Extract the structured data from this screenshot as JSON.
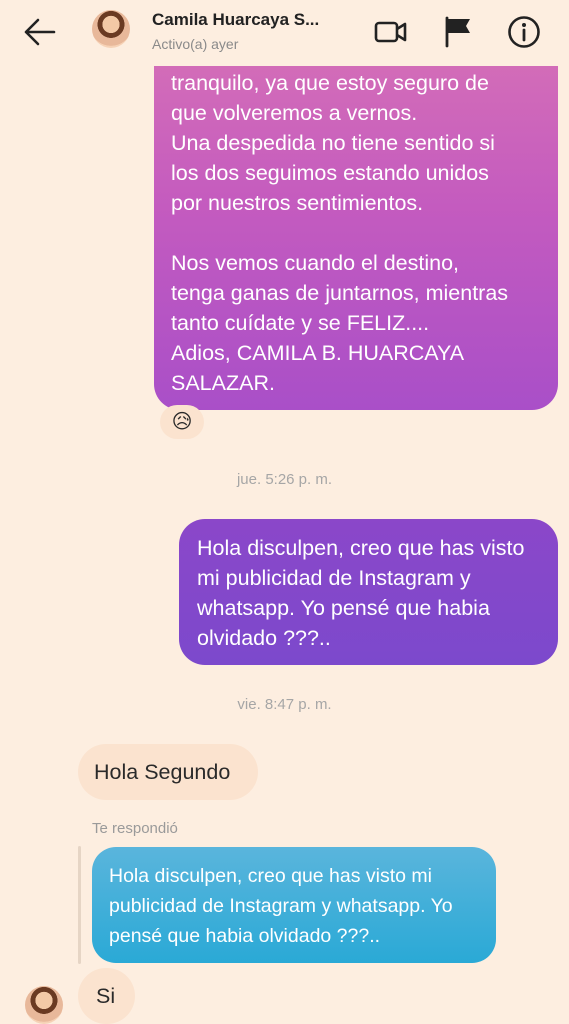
{
  "header": {
    "contact_name": "Camila Huarcaya S...",
    "status": "Activo(a) ayer"
  },
  "icons": {
    "back": "arrow-left-icon",
    "video": "video-camera-icon",
    "flag": "flag-icon",
    "info": "info-icon"
  },
  "messages": {
    "sent_1": "tranquilo, ya que estoy seguro de\nque volveremos a vernos.\nUna despedida no tiene sentido si\nlos dos seguimos estando unidos\npor nuestros sentimientos.\n\nNos vemos cuando el destino,\ntenga ganas de juntarnos, mientras\ntanto cuídate y se FELIZ....\nAdios, CAMILA B. HUARCAYA\nSALAZAR.",
    "reaction_1": "😥",
    "timestamp_1": "jue. 5:26 p. m.",
    "sent_2": "Hola disculpen, creo que has visto mi publicidad de Instagram y whatsapp. Yo pensé que habia olvidado ???..",
    "timestamp_2": "vie. 8:47 p. m.",
    "received_1": "Hola Segundo",
    "reply_label": "Te respondió",
    "quoted_text": "Hola disculpen, creo que has visto mi publicidad de Instagram y whatsapp. Yo pensé que habia olvidado ???..",
    "received_2": "Si"
  },
  "colors": {
    "background": "#fdeee0",
    "sent_gradient_top": "#d56fb7",
    "sent_gradient_bottom": "#7c49cc",
    "received_bubble": "#fbe3cf",
    "quoted_bubble": "#2aa9d6"
  }
}
